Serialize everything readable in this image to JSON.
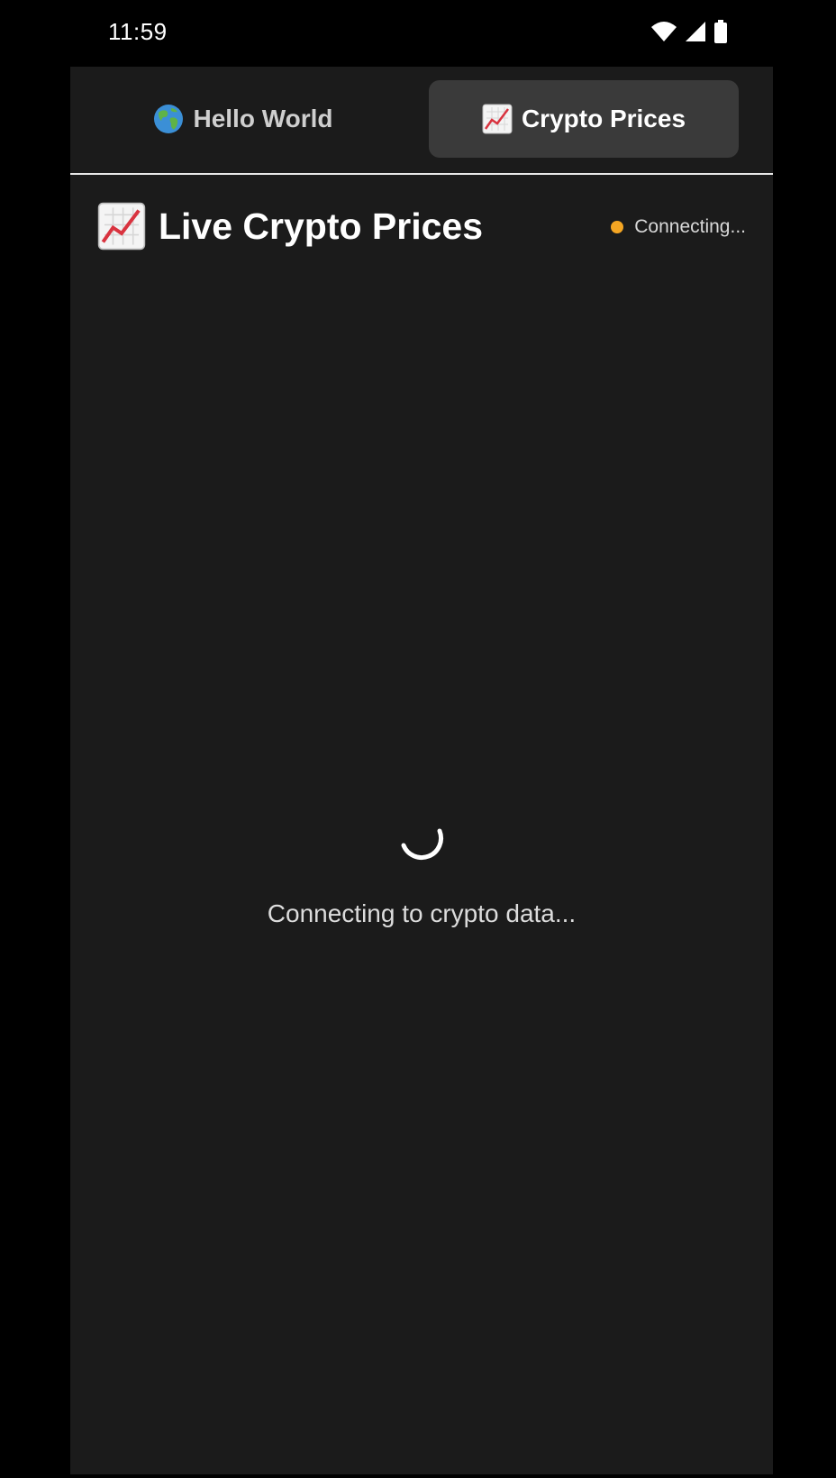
{
  "status_bar": {
    "time": "11:59",
    "icons": [
      "wifi-icon",
      "cell-signal-icon",
      "battery-icon"
    ]
  },
  "tabs": [
    {
      "icon": "globe-emoji",
      "label": "Hello World",
      "active": false
    },
    {
      "icon": "chart-increasing-emoji",
      "label": "Crypto Prices",
      "active": true
    }
  ],
  "header": {
    "icon": "chart-increasing-emoji",
    "title": "Live Crypto Prices",
    "connection_status": "Connecting...",
    "status_color": "#f5a623"
  },
  "main": {
    "loading_text": "Connecting to crypto data..."
  },
  "colors": {
    "background": "#1b1b1b",
    "active_tab": "#3a3a3a",
    "divider": "#e8e8e8"
  }
}
